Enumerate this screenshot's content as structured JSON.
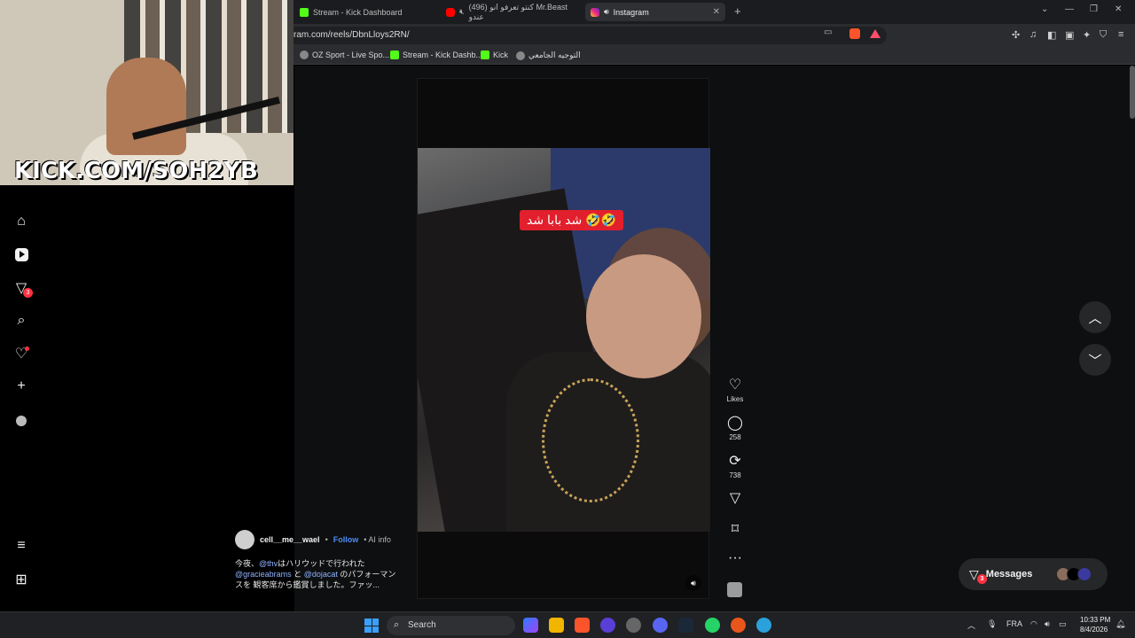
{
  "browser": {
    "tabs": [
      {
        "label": "Stream - Kick Dashboard",
        "favicon": "kick-icon"
      },
      {
        "label": "(496) كنتو تعرفو انو Mr.Beast عندو",
        "favicon": "youtube-icon"
      },
      {
        "label": "Instagram",
        "favicon": "instagram-icon",
        "active": true
      }
    ],
    "url": "ram.com/reels/DbnLloys2RN/",
    "bookmarks": [
      {
        "label": "OZ Sport - Live Spo..."
      },
      {
        "label": "Stream - Kick Dashb..."
      },
      {
        "label": "Kick"
      },
      {
        "label": "التوجيه الجامعي"
      }
    ]
  },
  "webcam": {
    "overlay_text": "KICK.COM/SOH2YB"
  },
  "sidebar": {
    "notifications_badge": "3"
  },
  "reel": {
    "caption": "شد بابا شد 🤣🤣",
    "actions": {
      "likes_label": "Likes",
      "comments_count": "258",
      "reposts_count": "738"
    },
    "author": {
      "username": "cell__me__wael",
      "separator": "•",
      "follow_label": "Follow",
      "ai_info": "• AI info"
    },
    "description": {
      "part1": "今夜、",
      "mention1": "@thv",
      "part2": "はハリウッドで行われた",
      "mention2": "@gracieabrams",
      "part3": " と ",
      "mention3": "@dojacat",
      "part4": " のパフォーマンスを 観客席から鑑賞しました。ファッ..."
    }
  },
  "messages": {
    "label": "Messages",
    "badge": "3"
  },
  "taskbar": {
    "search_placeholder": "Search",
    "language": "FRA",
    "time": "10:33 PM",
    "date": "8/4/2026"
  },
  "colors": {
    "accent_kick": "#53fc18",
    "instagram_link": "#4f8df7",
    "badge_red": "#ff3040"
  }
}
